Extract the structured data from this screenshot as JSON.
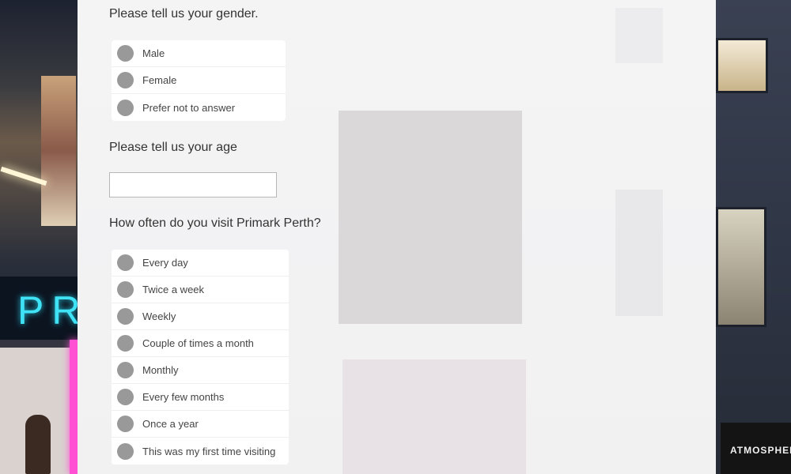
{
  "background": {
    "left_sign_text": "PRI",
    "right_store_text": "ATMOSPHER"
  },
  "questions": {
    "gender": {
      "label": "Please tell us your gender.",
      "options": [
        "Male",
        "Female",
        "Prefer not to answer"
      ]
    },
    "age": {
      "label": "Please tell us your age",
      "value": "",
      "placeholder": ""
    },
    "visit_frequency": {
      "label": "How often do you visit Primark Perth?",
      "options": [
        "Every day",
        "Twice a week",
        "Weekly",
        "Couple of times a month",
        "Monthly",
        "Every few months",
        "Once a year",
        "This was my first time visiting"
      ]
    }
  },
  "colors": {
    "radio": "#999999",
    "panel": "#f3f3f4",
    "text": "#333333"
  }
}
